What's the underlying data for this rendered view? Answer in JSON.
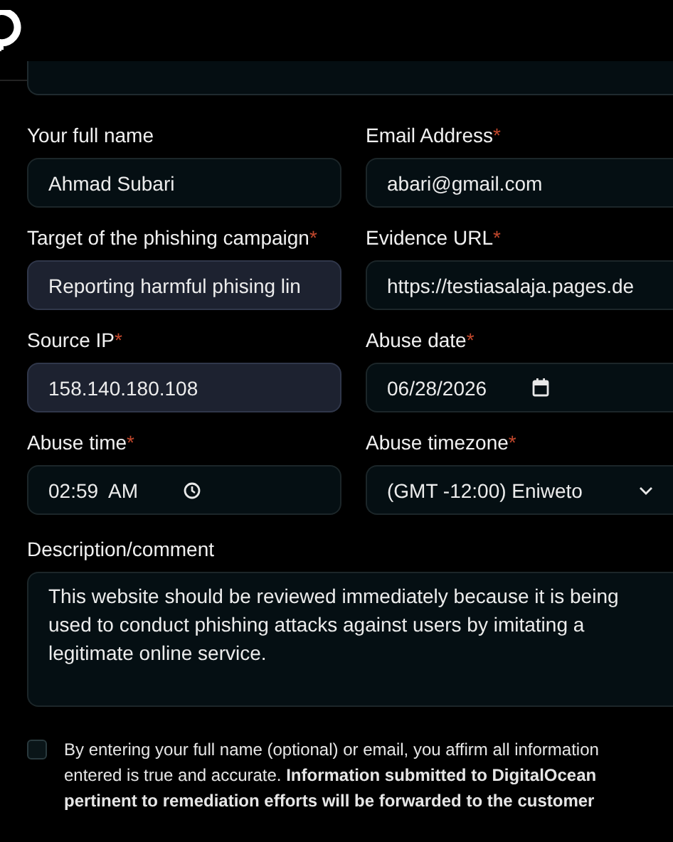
{
  "fields": [
    {
      "kind": "text",
      "label": "Your full name",
      "value": "Ahmad Subari",
      "autofilled": false
    },
    {
      "kind": "text",
      "label": "Email Address",
      "required_mark": "*",
      "value": "abari@gmail.com",
      "autofilled": false
    },
    {
      "kind": "text",
      "label": "Target of the phishing campaign",
      "required_mark": "*",
      "value": "Reporting harmful phising lin",
      "autofilled": true
    },
    {
      "kind": "text",
      "label": "Evidence URL",
      "required_mark": "*",
      "value": "https://testiasalaja.pages.de",
      "autofilled": false
    },
    {
      "kind": "text",
      "label": "Source IP",
      "required_mark": "*",
      "value": "158.140.180.108",
      "autofilled": true
    },
    {
      "kind": "date",
      "label": "Abuse date",
      "required_mark": "*",
      "value": "06/28/2026",
      "autofilled": false
    },
    {
      "kind": "time",
      "label": "Abuse time",
      "required_mark": "*",
      "value": "02:59  AM",
      "autofilled": false
    },
    {
      "kind": "select",
      "label": "Abuse timezone",
      "required_mark": "*",
      "value": "(GMT -12:00) Eniweto",
      "autofilled": false
    }
  ],
  "description": {
    "label": "Description/comment",
    "value": "This website should be reviewed immediately because it is being used to conduct phishing attacks against users by imitating a legitimate online service."
  },
  "consent": {
    "checked": false,
    "text": "By entering your full name (optional) or email, you affirm all information entered is true and accurate. **Information submitted to DigitalOcean pertinent to remediation efforts will be forwarded to the customer**"
  }
}
